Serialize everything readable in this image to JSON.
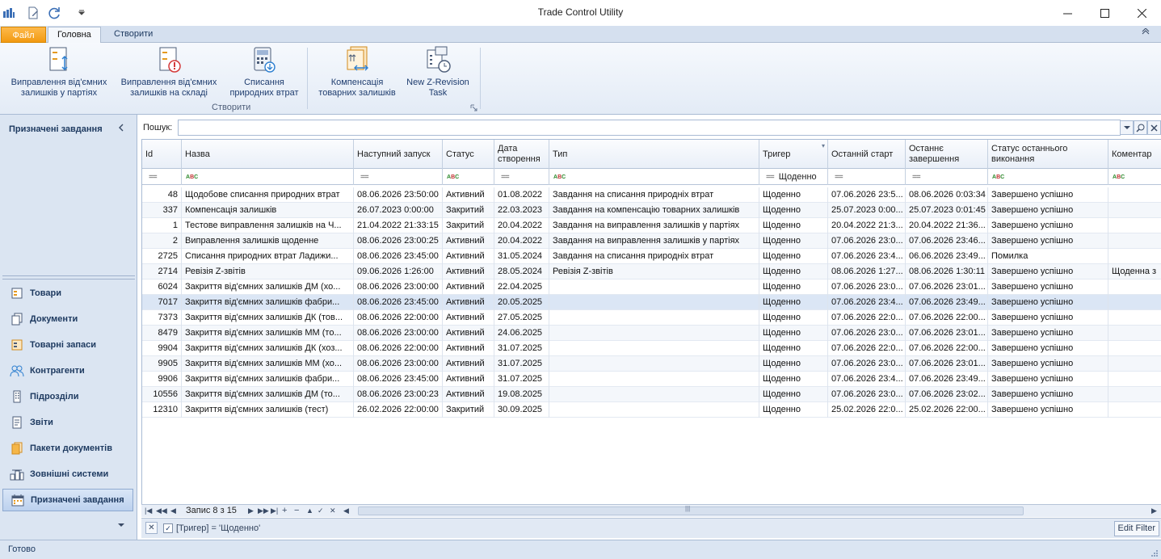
{
  "window": {
    "title": "Trade Control Utility"
  },
  "ribbon_tabs": {
    "file": "Файл",
    "home": "Головна",
    "create": "Створити"
  },
  "ribbon": {
    "btn1": [
      "Виправлення від'ємних",
      "залишків у партіях"
    ],
    "btn2": [
      "Виправлення від'ємних",
      "залишків на складі"
    ],
    "btn3": [
      "Списання",
      "природних втрат"
    ],
    "btn4": [
      "Компенсація",
      "товарних залишків"
    ],
    "btn5": [
      "New Z-Revision",
      "Task"
    ],
    "group_label": "Створити"
  },
  "nav": {
    "header": "Призначені завдання",
    "items": [
      {
        "label": "Товари",
        "icon": "goods-icon"
      },
      {
        "label": "Документи",
        "icon": "documents-icon"
      },
      {
        "label": "Товарні запаси",
        "icon": "stock-icon"
      },
      {
        "label": "Контрагенти",
        "icon": "counterparties-icon"
      },
      {
        "label": "Підрозділи",
        "icon": "departments-icon"
      },
      {
        "label": "Звіти",
        "icon": "reports-icon"
      },
      {
        "label": "Пакети документів",
        "icon": "document-packages-icon"
      },
      {
        "label": "Зовнішні системи",
        "icon": "external-systems-icon"
      },
      {
        "label": "Призначені завдання",
        "icon": "assigned-tasks-icon"
      }
    ]
  },
  "search": {
    "label": "Пошук:",
    "value": ""
  },
  "grid": {
    "columns": [
      "Id",
      "Назва",
      "Наступний запуск",
      "Статус",
      "Дата створення",
      "Тип",
      "Тригер",
      "Останній старт",
      "Останнє завершення",
      "Статус останнього виконання",
      "Коментар"
    ],
    "filter_trigger_value": "Щоденно",
    "rows": [
      [
        "48",
        "Щодобове списання природних втрат",
        "08.06.2026 23:50:00",
        "Активний",
        "01.08.2022",
        "Завдання на списання природніх втрат",
        "Щоденно",
        "07.06.2026 23:5...",
        "08.06.2026 0:03:34",
        "Завершено успішно",
        ""
      ],
      [
        "337",
        "Компенсація залишків",
        "26.07.2023 0:00:00",
        "Закритий",
        "22.03.2023",
        "Завдання на компенсацію товарних залишків",
        "Щоденно",
        "25.07.2023 0:00...",
        "25.07.2023 0:01:45",
        "Завершено успішно",
        ""
      ],
      [
        "1",
        "Тестове виправлення залишків на Ч...",
        "21.04.2022 21:33:15",
        "Закритий",
        "20.04.2022",
        "Завдання на виправлення залишків у партіях",
        "Щоденно",
        "20.04.2022 21:3...",
        "20.04.2022 21:36...",
        "Завершено успішно",
        ""
      ],
      [
        "2",
        "Виправлення залишків щоденне",
        "08.06.2026 23:00:25",
        "Активний",
        "20.04.2022",
        "Завдання на виправлення залишків у партіях",
        "Щоденно",
        "07.06.2026 23:0...",
        "07.06.2026 23:46...",
        "Завершено успішно",
        ""
      ],
      [
        "2725",
        "Списання природних втрат Ладижи...",
        "08.06.2026 23:45:00",
        "Активний",
        "31.05.2024",
        "Завдання на списання природніх втрат",
        "Щоденно",
        "07.06.2026 23:4...",
        "06.06.2026 23:49...",
        "Помилка",
        ""
      ],
      [
        "2714",
        "Ревізія Z-звітів",
        "09.06.2026 1:26:00",
        "Активний",
        "28.05.2024",
        "Ревізія Z-звітів",
        "Щоденно",
        "08.06.2026 1:27...",
        "08.06.2026 1:30:11",
        "Завершено успішно",
        "Щоденна з"
      ],
      [
        "6024",
        "Закриття від'ємних залишків ДМ (хо...",
        "08.06.2026 23:00:00",
        "Активний",
        "22.04.2025",
        "",
        "Щоденно",
        "07.06.2026 23:0...",
        "07.06.2026 23:01...",
        "Завершено успішно",
        ""
      ],
      [
        "7017",
        "Закриття від'ємних залишків фабри...",
        "08.06.2026 23:45:00",
        "Активний",
        "20.05.2025",
        "",
        "Щоденно",
        "07.06.2026 23:4...",
        "07.06.2026 23:49...",
        "Завершено успішно",
        ""
      ],
      [
        "7373",
        "Закриття від'ємних залишків ДК (тов...",
        "08.06.2026 22:00:00",
        "Активний",
        "27.05.2025",
        "",
        "Щоденно",
        "07.06.2026 22:0...",
        "07.06.2026 22:00...",
        "Завершено успішно",
        ""
      ],
      [
        "8479",
        "Закриття від'ємних залишків ММ (то...",
        "08.06.2026 23:00:00",
        "Активний",
        "24.06.2025",
        "",
        "Щоденно",
        "07.06.2026 23:0...",
        "07.06.2026 23:01...",
        "Завершено успішно",
        ""
      ],
      [
        "9904",
        "Закриття від'ємних залишків ДК (хоз...",
        "08.06.2026 22:00:00",
        "Активний",
        "31.07.2025",
        "",
        "Щоденно",
        "07.06.2026 22:0...",
        "07.06.2026 22:00...",
        "Завершено успішно",
        ""
      ],
      [
        "9905",
        "Закриття від'ємних залишків ММ (хо...",
        "08.06.2026 23:00:00",
        "Активний",
        "31.07.2025",
        "",
        "Щоденно",
        "07.06.2026 23:0...",
        "07.06.2026 23:01...",
        "Завершено успішно",
        ""
      ],
      [
        "9906",
        "Закриття від'ємних залишків фабри...",
        "08.06.2026 23:45:00",
        "Активний",
        "31.07.2025",
        "",
        "Щоденно",
        "07.06.2026 23:4...",
        "07.06.2026 23:49...",
        "Завершено успішно",
        ""
      ],
      [
        "10556",
        "Закриття від'ємних залишків ДМ (то...",
        "08.06.2026 23:00:23",
        "Активний",
        "19.08.2025",
        "",
        "Щоденно",
        "07.06.2026 23:0...",
        "07.06.2026 23:02...",
        "Завершено успішно",
        ""
      ],
      [
        "12310",
        "Закриття від'ємних залишків (тест)",
        "26.02.2026 22:00:00",
        "Закритий",
        "30.09.2025",
        "",
        "Щоденно",
        "25.02.2026 22:0...",
        "25.02.2026 22:00...",
        "Завершено успішно",
        ""
      ]
    ],
    "selected_row": 7
  },
  "navigator": {
    "record": "Запис 8 з 15"
  },
  "filter": {
    "text": "[Тригер] = 'Щоденно'",
    "edit_label": "Edit Filter"
  },
  "status": {
    "text": "Готово"
  },
  "colors": {
    "accent_file_tab": "#f29a12",
    "ribbon_bg": "#e3ebf6",
    "selected_row": "#dbe6f5"
  }
}
